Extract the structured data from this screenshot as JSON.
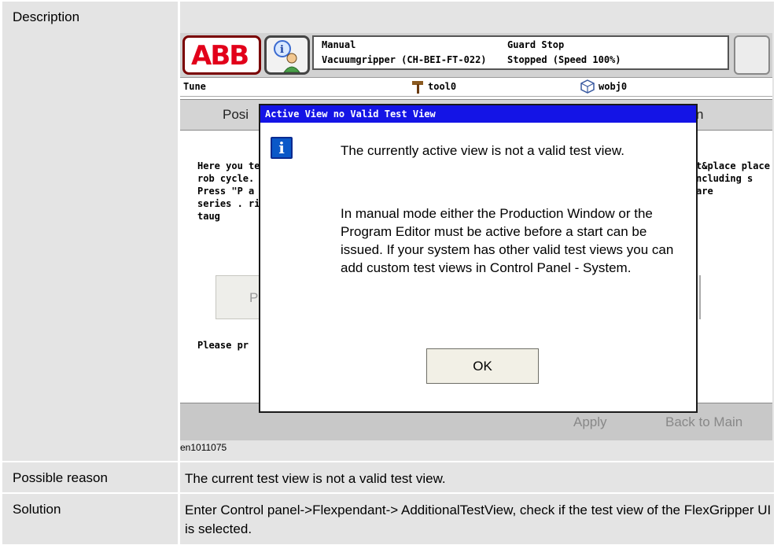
{
  "manual": {
    "rows": [
      {
        "label": "Description",
        "value": ""
      },
      {
        "label": "Possible reason",
        "value": "The current test view is not a valid test view."
      },
      {
        "label": "Solution",
        "value": "Enter Control panel->Flexpendant-> AdditionalTestView, check if the test view of the FlexGripper UI is selected."
      }
    ],
    "figure_id": "en1011075"
  },
  "flexpendant": {
    "logo": "ABB",
    "status": {
      "mode": "Manual",
      "system": "Vacuumgripper (CH-BEI-FT-022)",
      "state": "Guard Stop",
      "speed": "Stopped (Speed 100%)"
    },
    "infobar": {
      "view": "Tune",
      "tool": "tool0",
      "wobj": "wobj0"
    },
    "tabs": {
      "left": "Posi",
      "right": "n"
    },
    "body_left": "Here you test\" rob cycle. Ma Press \"P a series . right taug",
    "body_right": "t&place place ncluding s are",
    "bg_button_left": "P",
    "please_text": "Please pr",
    "bottom": {
      "apply": "Apply",
      "back": "Back to Main"
    },
    "dialog": {
      "title": "Active View no Valid Test View",
      "icon": "info-icon",
      "message1": "The currently active view is not a valid test view.",
      "message2": "In manual mode either the Production Window or the Program Editor must be active before a start can be issued. If your system has other valid test views you can add custom test views in Control Panel - System.",
      "ok": "OK"
    }
  }
}
